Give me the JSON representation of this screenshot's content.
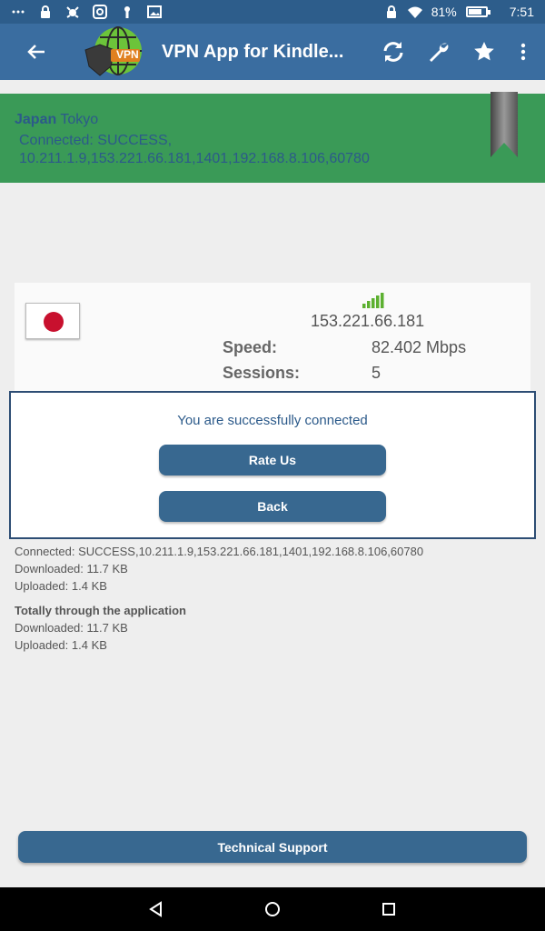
{
  "status_bar": {
    "battery": "81%",
    "battery_level": 0.81,
    "time": "7:51"
  },
  "app_bar": {
    "title": "VPN App for Kindle...",
    "logo_text": "VPN"
  },
  "banner": {
    "country": "Japan",
    "city": "Tokyo",
    "status": "Connected: SUCCESS,",
    "details": "10.211.1.9,153.221.66.181,1401,192.168.8.106,60780"
  },
  "server": {
    "ip": "153.221.66.181",
    "speed_label": "Speed:",
    "speed_value": "82.402 Mbps",
    "sessions_label": "Sessions:",
    "sessions_value": "5"
  },
  "dialog": {
    "message": "You are successfully connected",
    "rate_label": "Rate Us",
    "back_label": "Back"
  },
  "info": {
    "connected": "Connected: SUCCESS,10.211.1.9,153.221.66.181,1401,192.168.8.106,60780",
    "downloaded": "Downloaded: 11.7 KB",
    "uploaded": "Uploaded: 1.4 KB",
    "total_title": "Totally through the application",
    "total_downloaded": "Downloaded: 11.7 KB",
    "total_uploaded": "Uploaded: 1.4 KB"
  },
  "tech_support_label": "Technical Support",
  "colors": {
    "appbar": "#3a6da0",
    "banner": "#3a9a57",
    "button": "#386890"
  }
}
